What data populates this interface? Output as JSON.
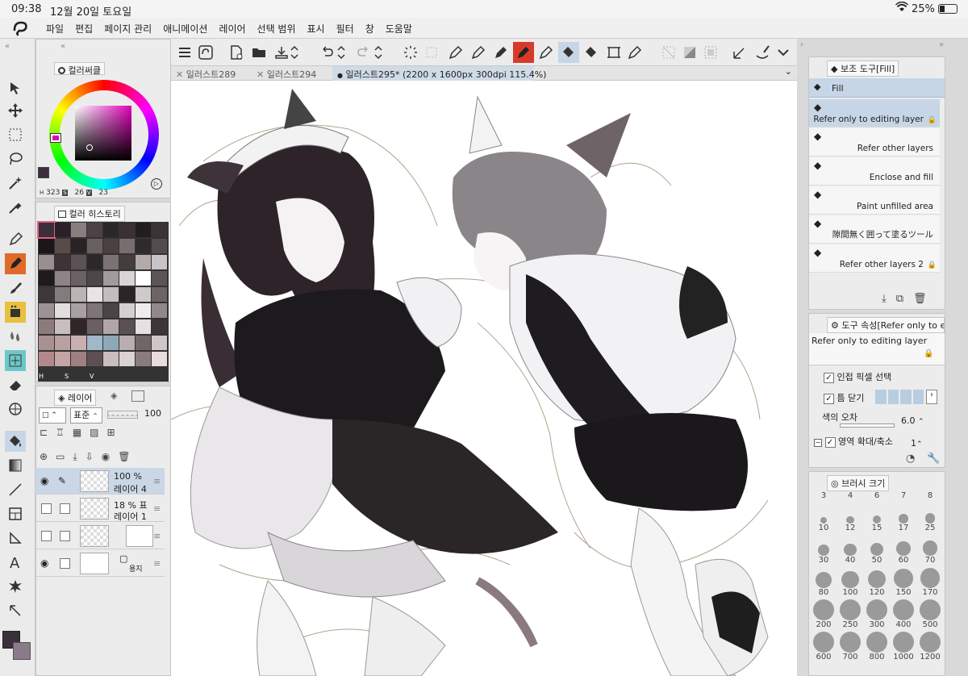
{
  "status": {
    "time": "09:38",
    "date": "12월 20일 토요일",
    "battery": "25%"
  },
  "menu": [
    "파일",
    "편집",
    "페이지 관리",
    "애니메이션",
    "레이어",
    "선택 범위",
    "표시",
    "필터",
    "창",
    "도움말"
  ],
  "colors": {
    "accent": "#c6d6e6",
    "active_tab": "#cfdbe7",
    "fill_tool": "#e06a2a",
    "main_color": "#3a2f3a",
    "sub_color": "#8a7a8a"
  },
  "color_circle": {
    "title": "컬러써클",
    "h_label": "H",
    "h": "323",
    "s_label": "S",
    "s": "26",
    "v_label": "V",
    "v": "23"
  },
  "color_history": {
    "title": "컬러 히스토리",
    "labels": [
      "H",
      "S",
      "V"
    ],
    "swatches": [
      "#3a2f3a",
      "#2a2128",
      "#8b7e7f",
      "#4d4245",
      "#2b2628",
      "#3c3035",
      "#231c20",
      "#3a3436",
      "#1c1517",
      "#5a4b4b",
      "#2a2325",
      "#6b6060",
      "#4a4042",
      "#7a6d6e",
      "#302a2c",
      "#554b4d",
      "#9a8f8f",
      "#3d3437",
      "#5c5254",
      "#2e2729",
      "#7c7274",
      "#453c3e",
      "#b5aaaa",
      "#c8c3c6",
      "#1f1a1c",
      "#8e8486",
      "#6a6163",
      "#4e4648",
      "#a39a9b",
      "#d9d4d6",
      "#ffffff",
      "#5d5456",
      "#3f3739",
      "#857b7d",
      "#bcb3b4",
      "#e8e4e6",
      "#c4bcbd",
      "#2b2326",
      "#cfc9ca",
      "#6e6466",
      "#9c9294",
      "#e2dede",
      "#a8a0a2",
      "#7f7577",
      "#4b4345",
      "#d4cfd1",
      "#f0ecee",
      "#928889",
      "#8d7b7c",
      "#c9bdbe",
      "#2e2628",
      "#6a5f61",
      "#b0a6a8",
      "#5a5052",
      "#e6e0e2",
      "#3d3537",
      "#aa9090",
      "#bba0a0",
      "#c9b0b0",
      "#a0b8c8",
      "#8ea8b8",
      "#b8aeb0",
      "#706668",
      "#d0c6c8",
      "#b08a8a",
      "#c4a4a4",
      "#9e8082",
      "#5e5052",
      "#cbbcbd",
      "#ddd2d3",
      "#8a7c7e",
      "#e8dcdd"
    ]
  },
  "layer_panel": {
    "title": "레이어",
    "blend_mode": "표준",
    "opacity": "100",
    "layers": [
      {
        "opacity": "100 %",
        "name": "레이어 4"
      },
      {
        "opacity": "18 %",
        "mode": "표",
        "name": "레이어 1"
      },
      {
        "opacity": "",
        "name": ""
      },
      {
        "opacity": "",
        "name": "용지"
      }
    ]
  },
  "doc_tabs": [
    "일러스트289",
    "일러스트294",
    "일러스트295* (2200 x 1600px 300dpi 115.4%)"
  ],
  "sub_tool": {
    "title": "보조 도구[Fill]",
    "group": "Fill",
    "items": [
      {
        "label": "Refer only to editing layer",
        "locked": true,
        "selected": true
      },
      {
        "label": "Refer other layers",
        "locked": false
      },
      {
        "label": "Enclose and fill",
        "locked": false
      },
      {
        "label": "Paint unfilled area",
        "locked": false
      },
      {
        "label": "隙間無く囲って塗るツール",
        "locked": false
      },
      {
        "label": "Refer other layers 2",
        "locked": true
      }
    ]
  },
  "tool_property": {
    "title": "도구 속성[Refer only to ed",
    "preset": "Refer only to editing layer",
    "adjacent": "인접 픽셀 선택",
    "close_gap": "틈 닫기",
    "color_margin": "색의 오차",
    "color_margin_value": "6.0",
    "expand": "영역 확대/축소",
    "expand_value": "1"
  },
  "brush_size": {
    "title": "브러시 크기",
    "top": [
      "3",
      "4",
      "6",
      "7",
      "8"
    ],
    "sizes": [
      "10",
      "12",
      "15",
      "17",
      "25",
      "30",
      "40",
      "50",
      "60",
      "70",
      "80",
      "100",
      "120",
      "150",
      "170",
      "200",
      "250",
      "300",
      "400",
      "500",
      "600",
      "700",
      "800",
      "1000",
      "1200"
    ]
  }
}
